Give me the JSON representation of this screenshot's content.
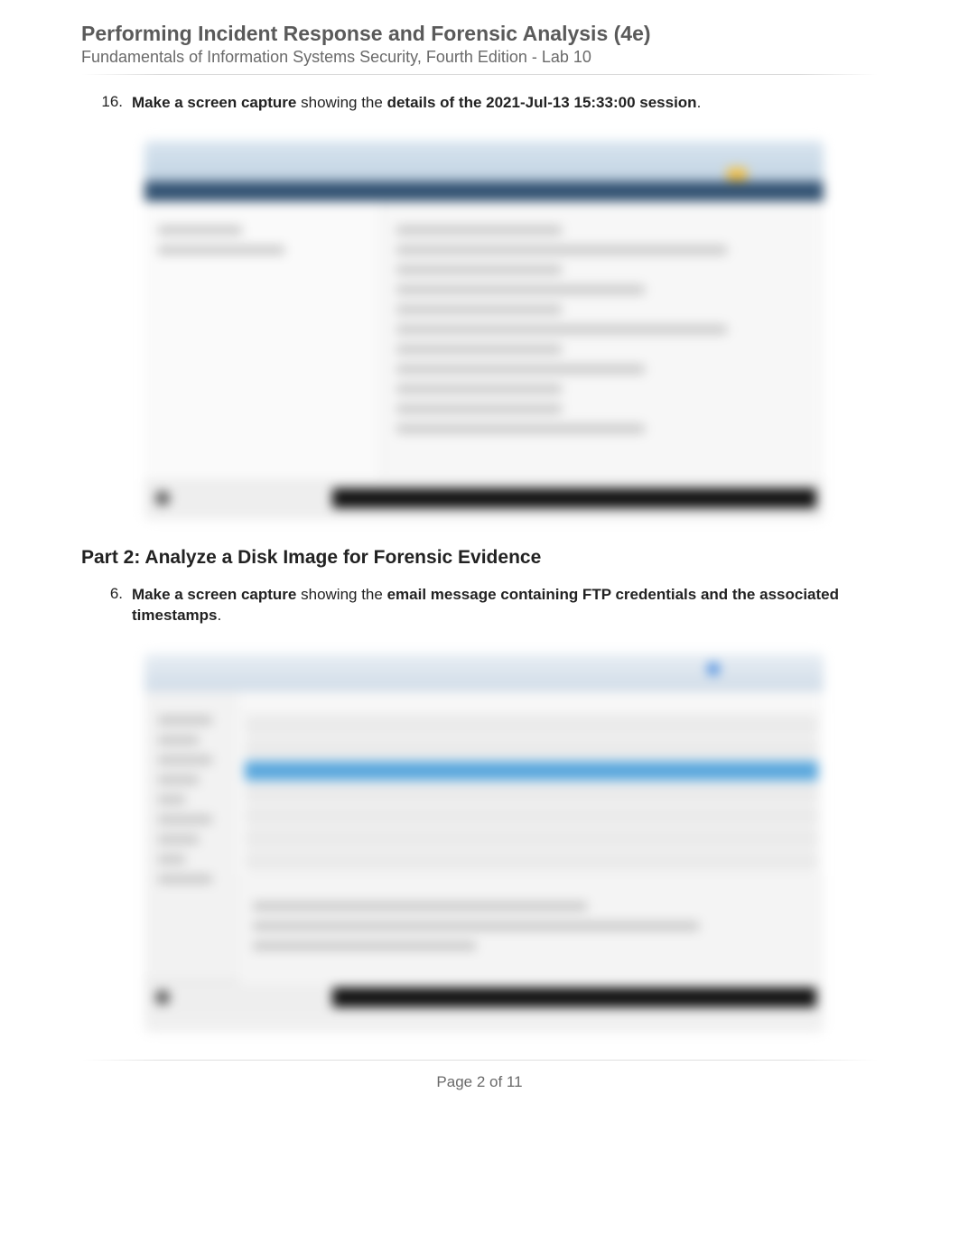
{
  "header": {
    "title": "Performing Incident Response and Forensic Analysis (4e)",
    "subtitle": "Fundamentals of Information Systems Security, Fourth Edition - Lab 10"
  },
  "items": {
    "item16": {
      "number": "16.",
      "bold1": "Make a screen capture",
      "text1": " showing the ",
      "bold2": "details of the 2021-Jul-13 15:33:00 session",
      "period": "."
    },
    "item6": {
      "number": "6.",
      "bold1": "Make a screen capture",
      "text1": " showing the ",
      "bold2": "email message containing FTP credentials and the associated timestamps",
      "period": "."
    }
  },
  "part2_heading": "Part 2: Analyze a Disk Image for Forensic Evidence",
  "footer": {
    "page_label": "Page 2 of 11"
  }
}
